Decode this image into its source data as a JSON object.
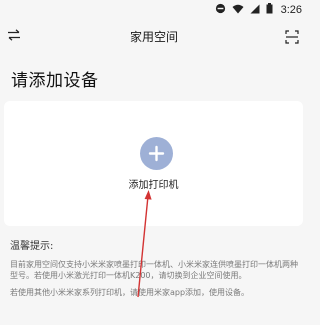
{
  "status_bar": {
    "time": "3:26",
    "icons": [
      "do-not-disturb-icon",
      "wifi-icon",
      "signal-icon",
      "battery-icon"
    ]
  },
  "nav": {
    "title": "家用空间",
    "left_icon": "switch-arrows-icon",
    "right_icon": "scan-icon"
  },
  "page": {
    "heading": "请添加设备",
    "add_label": "添加打印机",
    "accent_color": "#9eb0d6"
  },
  "tips": {
    "title": "温馨提示:",
    "body": "目前家用空间仅支持小米米家喷墨打印一体机、小米米家连供喷墨打印一体机两种型号。若使用小米激光打印一体机K200，请切换到企业空间使用。",
    "extra": "若使用其他小米米家系列打印机，请使用米家app添加，使用设备。"
  },
  "annotation": {
    "color": "#d33333"
  }
}
